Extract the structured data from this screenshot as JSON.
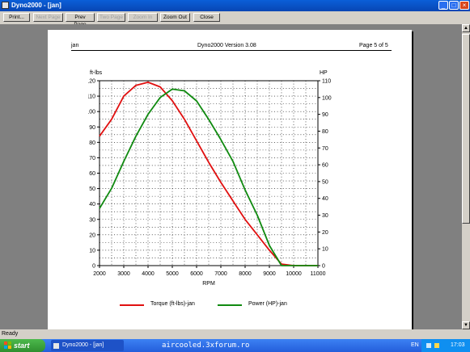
{
  "window": {
    "title": "Dyno2000 - [jan]",
    "buttons": [
      "_",
      "□",
      "×"
    ]
  },
  "toolbar": {
    "print": "Print...",
    "next_page": "Next Page",
    "prev_page": "Prev Page",
    "two_page": "Two Page",
    "zoom_in": "Zoom In",
    "zoom_out": "Zoom Out",
    "close": "Close"
  },
  "page": {
    "header_left": "jan",
    "header_center": "Dyno2000  Version 3.08",
    "header_right": "Page 5 of 5"
  },
  "legend": {
    "torque": "Torque (ft-lbs)-jan",
    "power": "Power (HP)-jan"
  },
  "chart_data": {
    "type": "line",
    "xlabel": "RPM",
    "ylabel_left": "ft-lbs",
    "ylabel_right": "HP",
    "xlim": [
      2000,
      11000
    ],
    "ylim_left": [
      0,
      120
    ],
    "ylim_right": [
      0,
      110
    ],
    "x_ticks": [
      2000,
      3000,
      4000,
      5000,
      6000,
      7000,
      8000,
      9000,
      10000,
      11000
    ],
    "y_ticks_left": [
      0,
      10,
      20,
      30,
      40,
      50,
      60,
      70,
      80,
      90,
      100,
      110,
      120
    ],
    "y_ticks_right": [
      0,
      10,
      20,
      30,
      40,
      50,
      60,
      70,
      80,
      90,
      100,
      110
    ],
    "grid": "dotted",
    "series": [
      {
        "name": "Torque (ft-lbs)-jan",
        "axis": "left",
        "color": "#e01010",
        "x": [
          2000,
          2500,
          3000,
          3500,
          4000,
          4500,
          5000,
          5500,
          6000,
          6500,
          7000,
          7500,
          8000,
          8500,
          9000,
          9500,
          10000,
          11000
        ],
        "y": [
          84,
          95,
          110,
          117,
          119,
          116,
          107,
          95,
          81,
          67,
          54,
          42,
          30,
          20,
          10,
          1,
          0,
          0
        ]
      },
      {
        "name": "Power (HP)-jan",
        "axis": "right",
        "color": "#108a10",
        "x": [
          2000,
          2500,
          3000,
          3500,
          4000,
          4500,
          5000,
          5500,
          6000,
          6500,
          7000,
          7500,
          8000,
          8500,
          9000,
          9500,
          10000,
          11000
        ],
        "y": [
          34,
          46,
          62,
          77,
          90,
          100,
          105,
          104,
          98,
          87,
          75,
          62,
          45,
          30,
          12,
          0,
          0,
          0
        ]
      }
    ]
  },
  "status": {
    "text": "Ready"
  },
  "taskbar": {
    "start": "start",
    "task": "Dyno2000 - [jan]",
    "watermark": "aircooled.3xforum.ro",
    "lang": "EN",
    "clock": "17:03"
  }
}
